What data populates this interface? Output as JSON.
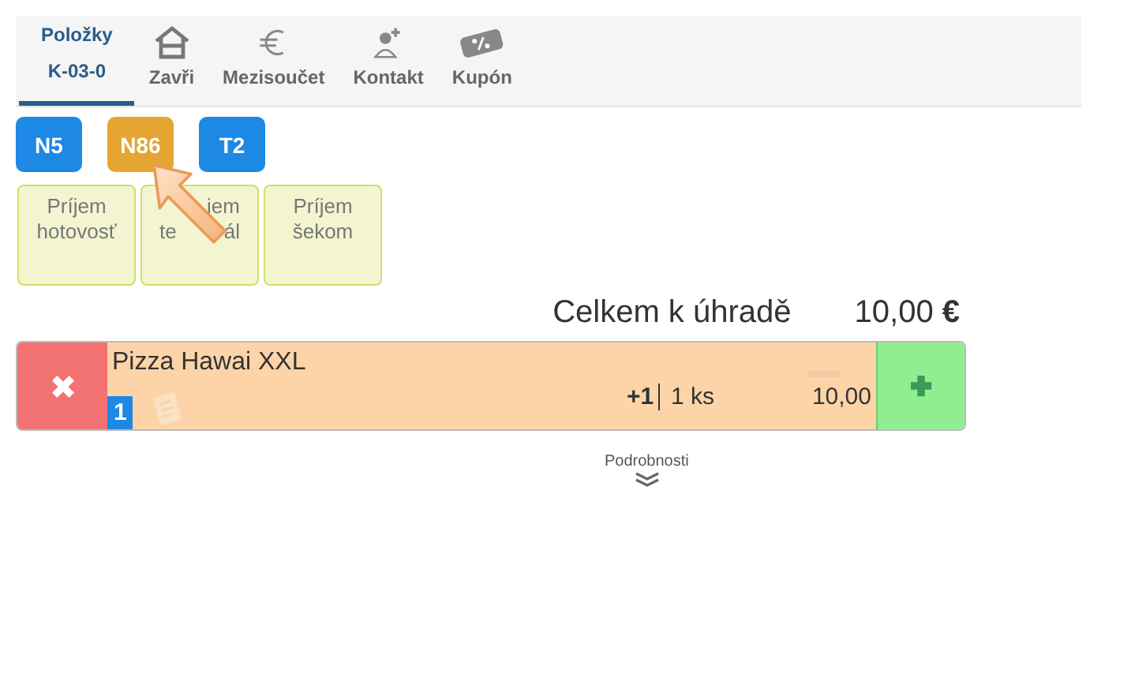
{
  "tabs": [
    {
      "kind": "text",
      "label": "Položky",
      "sublabel": "K-03-0",
      "selected": true
    },
    {
      "kind": "home",
      "label": "Zavři",
      "selected": false
    },
    {
      "kind": "euro",
      "label": "Mezisoučet",
      "selected": false
    },
    {
      "kind": "contact",
      "label": "Kontakt",
      "selected": false
    },
    {
      "kind": "coupon",
      "label": "Kupón",
      "selected": false
    }
  ],
  "tables": [
    {
      "label": "N5",
      "color": "#1e88e5"
    },
    {
      "label": "N86",
      "color": "#e5a532"
    },
    {
      "label": "T2",
      "color": "#1e88e5"
    }
  ],
  "payments": [
    {
      "lines": [
        {
          "text": "Príjem"
        },
        {
          "text": "hotovosť"
        }
      ]
    },
    {
      "lines": [
        {
          "after": "jem"
        },
        {
          "before": "te",
          "after": "ál"
        }
      ]
    },
    {
      "lines": [
        {
          "text": "Príjem"
        },
        {
          "text": "šekom"
        }
      ]
    }
  ],
  "total": {
    "label": "Celkem k úhradě",
    "amount": "10,00",
    "currency": "€"
  },
  "items": [
    {
      "name": "Pizza Hawai XXL",
      "seat": "1",
      "delta": "+1",
      "quantity": "1 ks",
      "price": "10,00"
    }
  ],
  "details": {
    "label": "Podrobnosti"
  }
}
